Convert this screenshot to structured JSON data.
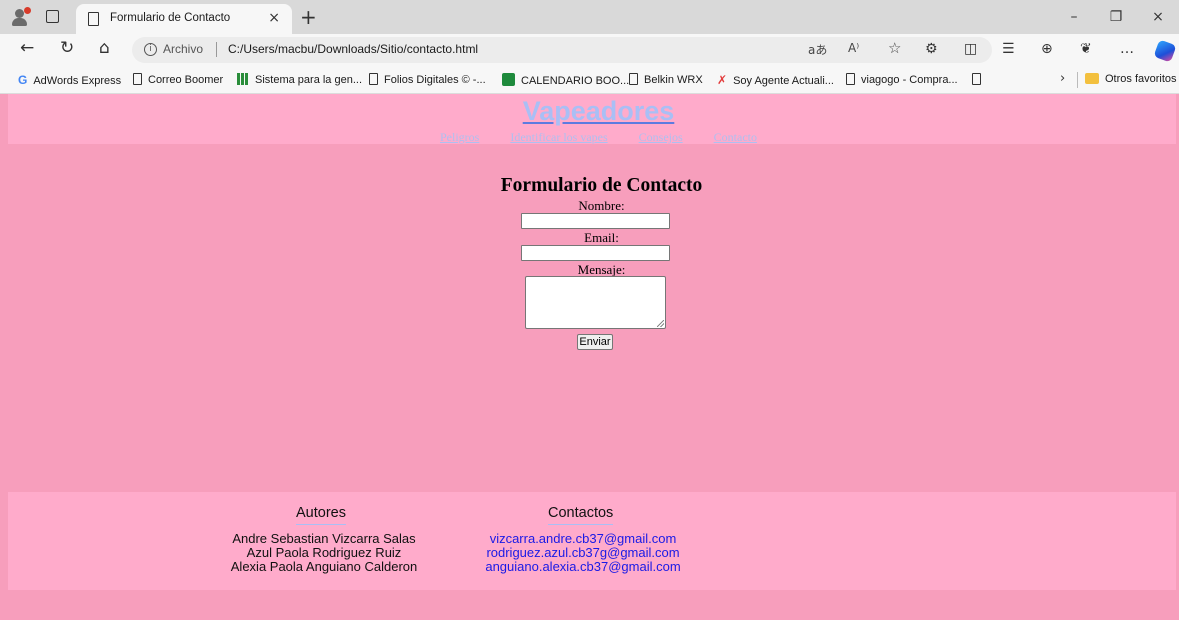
{
  "browser": {
    "tab_title": "Formulario de Contacto",
    "tab_close": "×",
    "new_tab": "+",
    "window_controls": {
      "minimize": "–",
      "restore": "❐",
      "close": "×"
    },
    "nav": {
      "back": "←",
      "refresh": "↻",
      "home": "⌂"
    },
    "address": {
      "scheme_label": "Archivo",
      "url": "C:/Users/macbu/Downloads/Sitio/contacto.html",
      "read_aloud": "aあ",
      "aa": "A⁾",
      "favorite": "☆"
    },
    "toolbar_icons": [
      "extensions-icon",
      "split-screen-icon",
      "favorites-list-icon",
      "collections-icon",
      "health-icon",
      "more-icon",
      "copilot-icon"
    ],
    "toolbar_glyphs": {
      "extensions": "⚙",
      "split": "◫",
      "favorites": "☰",
      "collections": "⊕",
      "health": "❦",
      "more": "…"
    },
    "bookmarks": [
      {
        "label": "AdWords Express",
        "icon": "google-icon"
      },
      {
        "label": "Correo Boomer",
        "icon": "page-icon"
      },
      {
        "label": "Sistema para la gen...",
        "icon": "grid-icon"
      },
      {
        "label": "Folios Digitales © -...",
        "icon": "page-icon"
      },
      {
        "label": "CALENDARIO BOO...",
        "icon": "calendar-icon"
      },
      {
        "label": "Belkin WRX",
        "icon": "page-icon"
      },
      {
        "label": "Soy Agente Actuali...",
        "icon": "x-logo-icon"
      },
      {
        "label": "viagogo - Compra...",
        "icon": "page-icon"
      },
      {
        "label": "",
        "icon": "page-icon"
      }
    ],
    "bookmarks_more": "›",
    "other_favorites": "Otros favoritos"
  },
  "site": {
    "brand": "Vapeadores",
    "nav": [
      "Peligros",
      "Identificar los vapes",
      "Consejos",
      "Contacto"
    ]
  },
  "form": {
    "title": "Formulario de Contacto",
    "name_label": "Nombre:",
    "name_value": "",
    "email_label": "Email:",
    "email_value": "",
    "message_label": "Mensaje:",
    "message_value": "",
    "submit_label": "Enviar"
  },
  "footer": {
    "authors_heading": "Autores",
    "authors": [
      "Andre Sebastian Vizcarra Salas",
      "Azul Paola Rodriguez Ruiz",
      "Alexia Paola Anguiano Calderon"
    ],
    "contacts_heading": "Contactos",
    "contacts": [
      "vizcarra.andre.cb37@gmail.com",
      "rodriguez.azul.cb37g@gmail.com",
      "anguiano.alexia.cb37@gmail.com"
    ]
  },
  "colors": {
    "page_bg": "#f79ebc",
    "header_bg": "#ffabcb",
    "link": "#aebff0",
    "email_link": "#1a1ae6"
  }
}
